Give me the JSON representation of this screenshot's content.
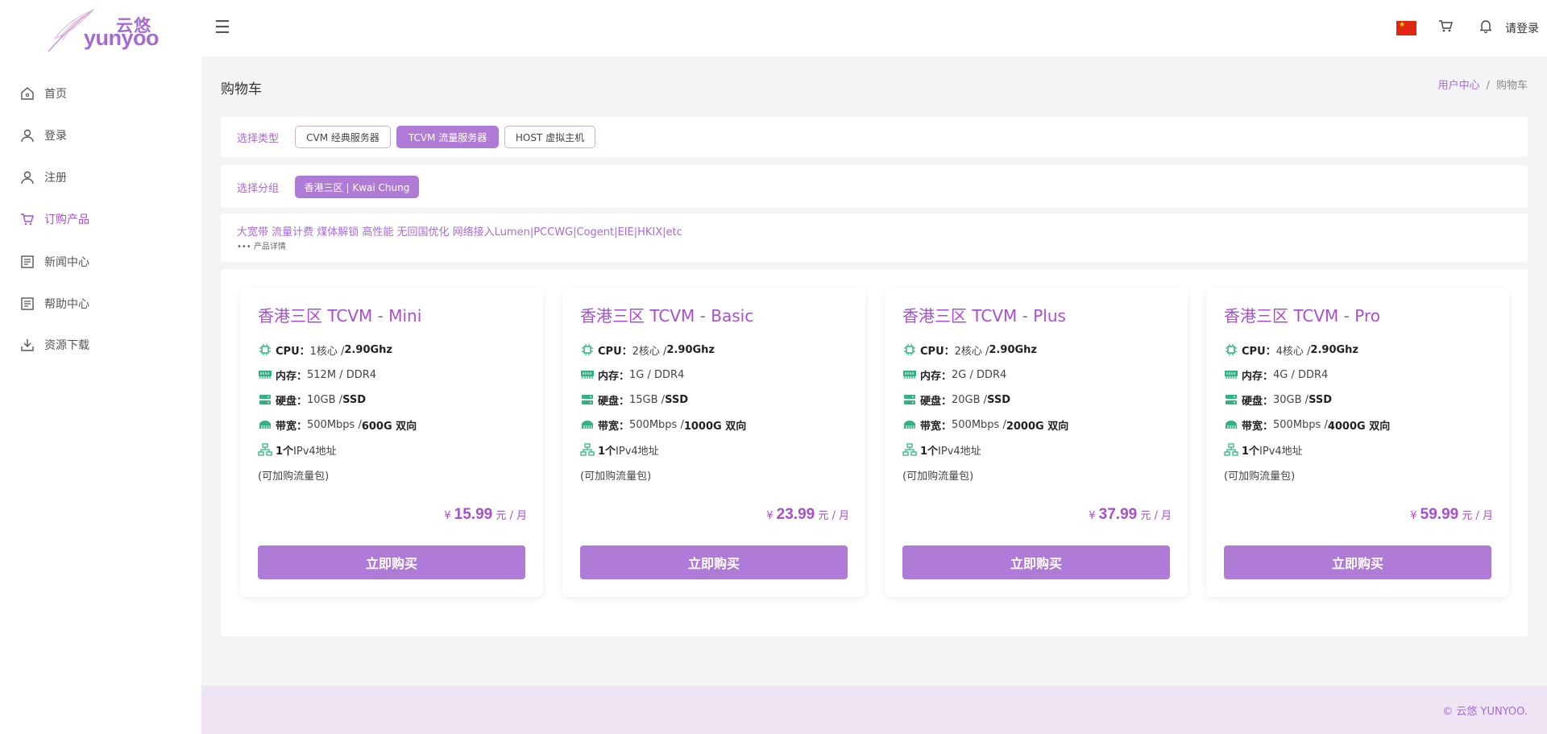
{
  "logo": {
    "cn": "云悠",
    "en": "yunyoo"
  },
  "header": {
    "login": "请登录"
  },
  "sidebar": {
    "items": [
      {
        "label": "首页"
      },
      {
        "label": "登录"
      },
      {
        "label": "注册"
      },
      {
        "label": "订购产品",
        "active": true
      },
      {
        "label": "新闻中心"
      },
      {
        "label": "帮助中心"
      },
      {
        "label": "资源下载"
      }
    ]
  },
  "page": {
    "title": "购物车",
    "breadcrumb": {
      "home": "用户中心",
      "sep": "/",
      "current": "购物车"
    }
  },
  "filters": {
    "type_label": "选择类型",
    "types": [
      {
        "label": "CVM 经典服务器"
      },
      {
        "label": "TCVM 流量服务器",
        "selected": true
      },
      {
        "label": "HOST 虚拟主机"
      }
    ],
    "group_label": "选择分组",
    "groups": [
      {
        "label": "香港三区 | Kwai Chung",
        "selected": true
      }
    ]
  },
  "description": {
    "text": "大宽带 流量计费 煤体解锁 高性能 无回国优化 网络接入Lumen|PCCWG|Cogent|EIE|HKIX|etc",
    "more": "••• 产品详情"
  },
  "products": [
    {
      "title": "香港三区 TCVM - Mini",
      "cpu": {
        "key": "CPU：",
        "val": "1核心 / ",
        "strong": "2.90Ghz"
      },
      "mem": {
        "key": "内存：",
        "val": "512M / DDR4"
      },
      "disk": {
        "key": "硬盘：",
        "val": "10GB / ",
        "strong": "SSD"
      },
      "bw": {
        "key": "带宽：",
        "val": "500Mbps / ",
        "strong": "600G 双向"
      },
      "ip": {
        "strong": "1个",
        "val": " IPv4地址"
      },
      "note": "(可加购流量包)",
      "price": {
        "currency": "¥",
        "amount": "15.99",
        "unit": " 元 / 月"
      },
      "buy": "立即购买"
    },
    {
      "title": "香港三区 TCVM - Basic",
      "cpu": {
        "key": "CPU：",
        "val": "2核心 / ",
        "strong": "2.90Ghz"
      },
      "mem": {
        "key": "内存：",
        "val": "1G / DDR4"
      },
      "disk": {
        "key": "硬盘：",
        "val": "15GB / ",
        "strong": "SSD"
      },
      "bw": {
        "key": "带宽：",
        "val": "500Mbps / ",
        "strong": "1000G 双向"
      },
      "ip": {
        "strong": "1个",
        "val": " IPv4地址"
      },
      "note": "(可加购流量包)",
      "price": {
        "currency": "¥",
        "amount": "23.99",
        "unit": " 元 / 月"
      },
      "buy": "立即购买"
    },
    {
      "title": "香港三区 TCVM - Plus",
      "cpu": {
        "key": "CPU：",
        "val": "2核心 / ",
        "strong": "2.90Ghz"
      },
      "mem": {
        "key": "内存：",
        "val": "2G / DDR4"
      },
      "disk": {
        "key": "硬盘：",
        "val": "20GB / ",
        "strong": "SSD"
      },
      "bw": {
        "key": "带宽：",
        "val": "500Mbps / ",
        "strong": "2000G 双向"
      },
      "ip": {
        "strong": "1个",
        "val": " IPv4地址"
      },
      "note": "(可加购流量包)",
      "price": {
        "currency": "¥",
        "amount": "37.99",
        "unit": " 元 / 月"
      },
      "buy": "立即购买"
    },
    {
      "title": "香港三区 TCVM - Pro",
      "cpu": {
        "key": "CPU：",
        "val": "4核心 / ",
        "strong": "2.90Ghz"
      },
      "mem": {
        "key": "内存：",
        "val": "4G / DDR4"
      },
      "disk": {
        "key": "硬盘：",
        "val": "30GB / ",
        "strong": "SSD"
      },
      "bw": {
        "key": "带宽：",
        "val": "500Mbps / ",
        "strong": "4000G 双向"
      },
      "ip": {
        "strong": "1个",
        "val": " IPv4地址"
      },
      "note": "(可加购流量包)",
      "price": {
        "currency": "¥",
        "amount": "59.99",
        "unit": " 元 / 月"
      },
      "buy": "立即购买"
    }
  ],
  "footer": {
    "copyright": "© 云悠 YUNYOO."
  },
  "colors": {
    "accent": "#a84fd0",
    "button": "#b07bd6",
    "icon_green": "#2fb380"
  }
}
